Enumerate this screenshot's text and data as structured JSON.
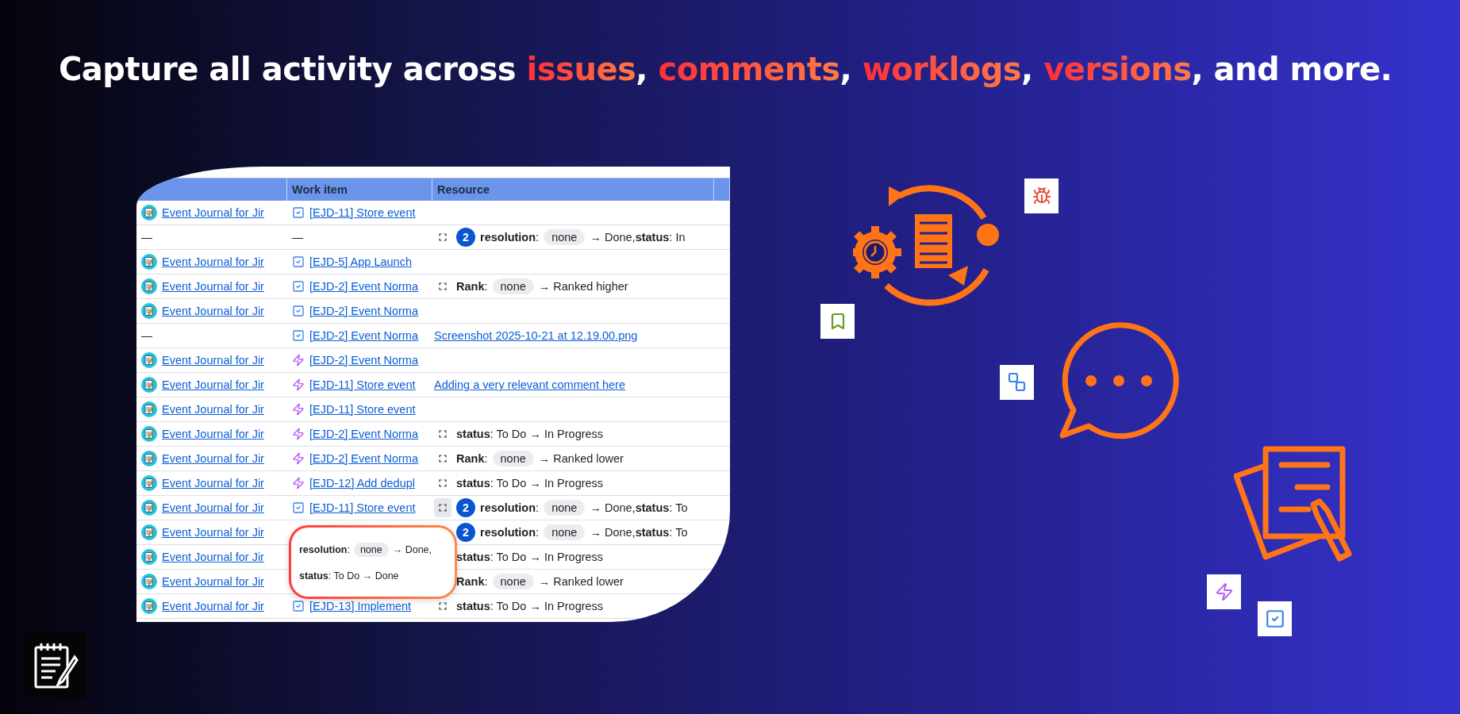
{
  "headline": [
    {
      "text": "Capture all activity across ",
      "highlight": false
    },
    {
      "text": "issues",
      "highlight": true
    },
    {
      "text": ", ",
      "highlight": false
    },
    {
      "text": "comments",
      "highlight": true
    },
    {
      "text": ", ",
      "highlight": false
    },
    {
      "text": "worklogs",
      "highlight": true
    },
    {
      "text": ", ",
      "highlight": false
    },
    {
      "text": "versions",
      "highlight": true
    },
    {
      "text": ", and more.",
      "highlight": false
    }
  ],
  "table": {
    "columns": [
      "Work item",
      "Resource"
    ],
    "rows": [
      {
        "project": {
          "kind": "app",
          "text": "Event Journal for Jir"
        },
        "item": {
          "kind": "task",
          "text": "[EJD-11] Store event"
        },
        "resource": {
          "kind": "empty"
        }
      },
      {
        "project": {
          "kind": "dash",
          "text": "—"
        },
        "item": {
          "kind": "dash",
          "text": "—"
        },
        "resource": {
          "kind": "change",
          "toggle": true,
          "active": false,
          "count": "2",
          "before": "**resolution**:",
          "pill": "none",
          "after": "→ Done,**status**: In"
        }
      },
      {
        "project": {
          "kind": "app",
          "text": "Event Journal for Jir"
        },
        "item": {
          "kind": "task",
          "text": "[EJD-5] App Launch"
        },
        "resource": {
          "kind": "empty"
        }
      },
      {
        "project": {
          "kind": "app",
          "text": "Event Journal for Jir"
        },
        "item": {
          "kind": "task",
          "text": "[EJD-2] Event Norma"
        },
        "resource": {
          "kind": "change",
          "toggle": true,
          "active": false,
          "before": "**Rank**:",
          "pill": "none",
          "after": "→ Ranked higher"
        }
      },
      {
        "project": {
          "kind": "app",
          "text": "Event Journal for Jir"
        },
        "item": {
          "kind": "task",
          "text": "[EJD-2] Event Norma"
        },
        "resource": {
          "kind": "empty"
        }
      },
      {
        "project": {
          "kind": "dash",
          "text": "—"
        },
        "item": {
          "kind": "task",
          "text": "[EJD-2] Event Norma"
        },
        "resource": {
          "kind": "link",
          "text": "Screenshot 2025-10-21 at 12.19.00.png"
        }
      },
      {
        "project": {
          "kind": "app",
          "text": "Event Journal for Jir"
        },
        "item": {
          "kind": "bolt",
          "text": "[EJD-2] Event Norma"
        },
        "resource": {
          "kind": "empty"
        }
      },
      {
        "project": {
          "kind": "app",
          "text": "Event Journal for Jir"
        },
        "item": {
          "kind": "bolt",
          "text": "[EJD-11] Store event"
        },
        "resource": {
          "kind": "link",
          "text": "Adding a very relevant comment here"
        }
      },
      {
        "project": {
          "kind": "app",
          "text": "Event Journal for Jir"
        },
        "item": {
          "kind": "bolt",
          "text": "[EJD-11] Store event"
        },
        "resource": {
          "kind": "empty"
        }
      },
      {
        "project": {
          "kind": "app",
          "text": "Event Journal for Jir"
        },
        "item": {
          "kind": "bolt",
          "text": "[EJD-2] Event Norma"
        },
        "resource": {
          "kind": "change",
          "toggle": true,
          "active": false,
          "before": "**status**: To Do → In Progress"
        }
      },
      {
        "project": {
          "kind": "app",
          "text": "Event Journal for Jir"
        },
        "item": {
          "kind": "bolt",
          "text": "[EJD-2] Event Norma"
        },
        "resource": {
          "kind": "change",
          "toggle": true,
          "active": false,
          "before": "**Rank**:",
          "pill": "none",
          "after": "→ Ranked lower"
        }
      },
      {
        "project": {
          "kind": "app",
          "text": "Event Journal for Jir"
        },
        "item": {
          "kind": "bolt",
          "text": "[EJD-12] Add dedupl"
        },
        "resource": {
          "kind": "change",
          "toggle": true,
          "active": false,
          "before": "**status**: To Do → In Progress"
        }
      },
      {
        "project": {
          "kind": "app",
          "text": "Event Journal for Jir"
        },
        "item": {
          "kind": "task",
          "text": "[EJD-11] Store event"
        },
        "resource": {
          "kind": "change",
          "toggle": true,
          "active": true,
          "count": "2",
          "before": "**resolution**:",
          "pill": "none",
          "after": "→ Done,**status**: To"
        }
      },
      {
        "project": {
          "kind": "app",
          "text": "Event Journal for Jir"
        },
        "item": {
          "kind": "hidden"
        },
        "resource": {
          "kind": "change",
          "count": "2",
          "before": "**resolution**:",
          "pill": "none",
          "after": "→ Done,**status**: To"
        }
      },
      {
        "project": {
          "kind": "app",
          "text": "Event Journal for Jir"
        },
        "item": {
          "kind": "hidden"
        },
        "resource": {
          "kind": "change",
          "before": "**status**: To Do → In Progress"
        }
      },
      {
        "project": {
          "kind": "app",
          "text": "Event Journal for Jir"
        },
        "item": {
          "kind": "hidden"
        },
        "resource": {
          "kind": "change",
          "before": "**Rank**:",
          "pill": "none",
          "after": "→ Ranked lower"
        }
      },
      {
        "project": {
          "kind": "app",
          "text": "Event Journal for Jir"
        },
        "item": {
          "kind": "task",
          "text": "[EJD-13] Implement"
        },
        "resource": {
          "kind": "change",
          "toggle": true,
          "active": false,
          "before": "**status**: To Do → In Progress"
        }
      }
    ],
    "popover": {
      "lines": [
        {
          "before": "**resolution**:",
          "pill": "none",
          "after": "→ Done,"
        },
        {
          "before": "**status**: To Do → Done"
        }
      ]
    }
  }
}
